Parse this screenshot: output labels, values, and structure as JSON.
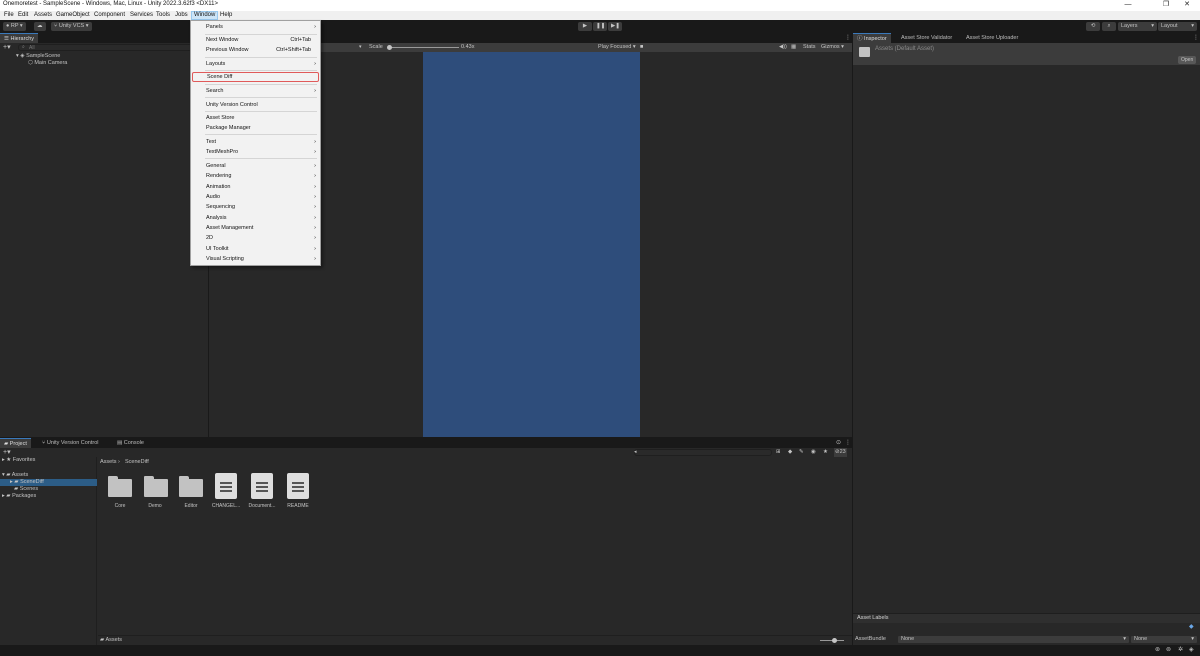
{
  "window": {
    "title": "Onemoretest - SampleScene - Windows, Mac, Linux - Unity 2022.3.62f3 <DX11>",
    "minimize_glyph": "—",
    "maximize_glyph": "❐",
    "close_glyph": "✕"
  },
  "menubar": [
    "File",
    "Edit",
    "Assets",
    "GameObject",
    "Component",
    "Services",
    "Tools",
    "Jobs",
    "Window",
    "Help"
  ],
  "toolbar": {
    "account": "RP",
    "vcs": "Unity VCS",
    "layers": "Layers",
    "layout": "Layout"
  },
  "hierarchy": {
    "tab": "Hierarchy",
    "search_placeholder": "All",
    "scene": "SampleScene",
    "items": [
      "Main Camera"
    ]
  },
  "game_view": {
    "scale_label": "Scale",
    "scale_value": "0.43x",
    "play_focused": "Play Focused",
    "stats": "Stats",
    "gizmos": "Gizmos"
  },
  "window_menu": {
    "items": [
      {
        "label": "Panels",
        "arrow": true
      },
      {
        "label": "Next Window",
        "shortcut": "Ctrl+Tab"
      },
      {
        "label": "Previous Window",
        "shortcut": "Ctrl+Shift+Tab"
      },
      {
        "label": "Layouts",
        "arrow": true
      },
      {
        "label": "Scene Diff"
      },
      {
        "label": "Search",
        "arrow": true
      },
      {
        "label": "Unity Version Control"
      },
      {
        "label": "Asset Store"
      },
      {
        "label": "Package Manager"
      },
      {
        "label": "Text",
        "arrow": true
      },
      {
        "label": "TextMeshPro",
        "arrow": true
      },
      {
        "label": "General",
        "arrow": true
      },
      {
        "label": "Rendering",
        "arrow": true
      },
      {
        "label": "Animation",
        "arrow": true
      },
      {
        "label": "Audio",
        "arrow": true
      },
      {
        "label": "Sequencing",
        "arrow": true
      },
      {
        "label": "Analysis",
        "arrow": true
      },
      {
        "label": "Asset Management",
        "arrow": true
      },
      {
        "label": "2D",
        "arrow": true
      },
      {
        "label": "UI Toolkit",
        "arrow": true
      },
      {
        "label": "Visual Scripting",
        "arrow": true
      }
    ]
  },
  "inspector": {
    "tabs": [
      "Inspector",
      "Asset Store Validator",
      "Asset Store Uploader"
    ],
    "header": "Assets (Default Asset)",
    "open_button": "Open",
    "asset_labels": "Asset Labels",
    "asset_bundle_label": "AssetBundle",
    "asset_bundle_value": "None",
    "variant_value": "None"
  },
  "project": {
    "tabs": [
      "Project",
      "Unity Version Control",
      "Console"
    ],
    "favorites": "Favorites",
    "tree": {
      "root": "Assets",
      "children": [
        "SceneDiff",
        "Scenes"
      ],
      "packages": "Packages"
    },
    "breadcrumb": [
      "Assets",
      "SceneDiff"
    ],
    "hidden_count": "23",
    "assets": [
      {
        "name": "Core",
        "type": "folder"
      },
      {
        "name": "Demo",
        "type": "folder"
      },
      {
        "name": "Editor",
        "type": "folder"
      },
      {
        "name": "CHANGEL...",
        "type": "doc"
      },
      {
        "name": "Document...",
        "type": "doc"
      },
      {
        "name": "README",
        "type": "doc"
      }
    ],
    "footer_path": "Assets"
  },
  "colors": {
    "accent": "#3a79bb",
    "selection": "#2c5d87",
    "game_bg": "#2e4d7b",
    "highlight_outline": "#e05a5a"
  }
}
